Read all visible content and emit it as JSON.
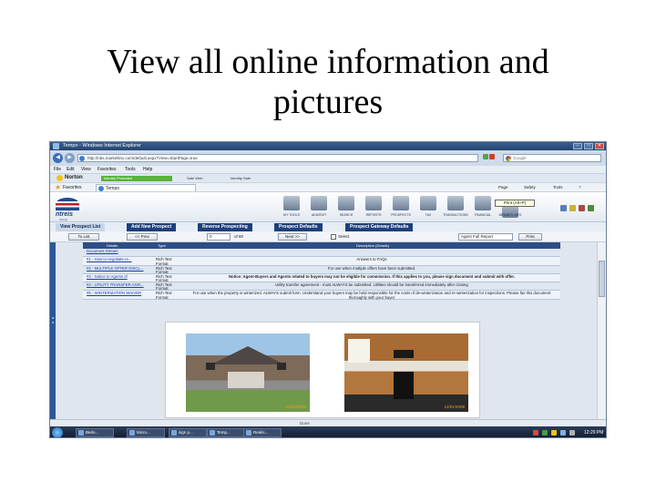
{
  "slide": {
    "title_line1": "View all online information and",
    "title_line2": "pictures"
  },
  "browser": {
    "window_title": "Tempo - Windows Internet Explorer",
    "address": "http://nbs.marketlinx.com/default.aspx?View=StartPage=true",
    "search_placeholder": "Google",
    "menu": [
      "File",
      "Edit",
      "View",
      "Favorites",
      "Tools",
      "Help"
    ],
    "norton_label": "Norton",
    "norton_status": "Identity Protected",
    "norton_btn1": "Safe Web",
    "norton_btn2": "Identity Safe",
    "favorites_label": "Favorites",
    "tab_label": "Tempo",
    "right_tools": [
      "Page",
      "Safety",
      "Tools"
    ],
    "window_buttons": [
      "–",
      "□",
      "✕"
    ]
  },
  "app": {
    "logo": "ntreis",
    "logo_sub": "listings",
    "toolbar": [
      {
        "label": "MY TOOLS"
      },
      {
        "label": "ADD/EDIT"
      },
      {
        "label": "SEARCH"
      },
      {
        "label": "REPORTS"
      },
      {
        "label": "PROSPECTS"
      },
      {
        "label": "TAX"
      },
      {
        "label": "TRANSACTIONS"
      },
      {
        "label": "FINANCIAL"
      },
      {
        "label": "MEMBER INFO"
      }
    ],
    "print_tooltip": "Print (Alt+P)"
  },
  "tabs": [
    {
      "label": "View Prospect List",
      "active": true
    },
    {
      "label": "Add New Prospect",
      "active": false
    },
    {
      "label": "Reverse Prospecting",
      "active": false
    },
    {
      "label": "Prospect Defaults",
      "active": false
    },
    {
      "label": "Prospect Gateway Defaults",
      "active": false
    }
  ],
  "controls": {
    "to_list": "To List",
    "prev": "<< Prev",
    "page_value": "0",
    "of_text": "of 80",
    "next": "Next >>",
    "select_label": "Select",
    "report_select": "Agent Full Report",
    "print": "Print"
  },
  "table": {
    "headers": [
      "Details",
      "Type",
      "Description (Details)"
    ],
    "rows": [
      {
        "doc": "Document Stream",
        "type": "",
        "desc": "",
        "bold": false
      },
      {
        "doc": "#1 - How to negotiate re...",
        "type": "Rich Text Format",
        "desc": "Answers to FAQs",
        "bold": false
      },
      {
        "doc": "#2 - MULTIPLE OFFER DISCL...",
        "type": "Rich Text Format",
        "desc": "For use when multiple offers have been submitted.",
        "bold": false
      },
      {
        "doc": "#3 - Notice to Agents of",
        "type": "Rich Text Format",
        "desc": "Notice: Agent-Buyers and Agents related to buyers may not be eligible for commission. If this applies to you, please sign document and submit with offer.",
        "bold": true
      },
      {
        "doc": "#4 - UTILITY TRANSFER AGR...",
        "type": "Rich Text Format",
        "desc": "Utility transfer agreement - must ALWAYS be submitted. Utilities should be transferred immediately after closing",
        "bold": false
      },
      {
        "doc": "#5 - WINTERIZATION WAIVER",
        "type": "Rich Text Format",
        "desc": "For use when the property is winterized. ALWAYS submit form. Understand your buyers may be held responsible for the costs of de-winterization and re-winterization for inspections. Please fax this document thoroughly with your buyer",
        "bold": false
      }
    ]
  },
  "photos": [
    {
      "kind": "house",
      "date": "12/01/2009"
    },
    {
      "kind": "kitchen",
      "date": "12/01/2009"
    }
  ],
  "statusbar": {
    "text": "Done"
  },
  "taskbar": {
    "items": [
      "Bedo...",
      "Micro...",
      "sign p...",
      "Temp...",
      "Realis..."
    ],
    "clock": "12:29 PM"
  }
}
